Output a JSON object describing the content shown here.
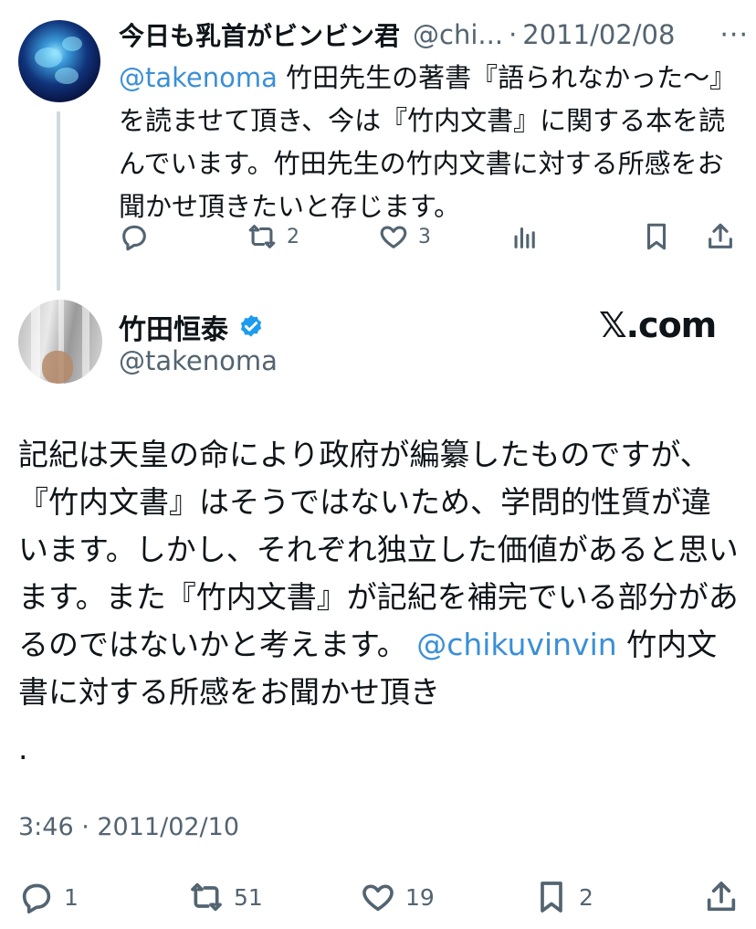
{
  "tweet1": {
    "author_name": "今日も乳首がビンビン君",
    "handle": "@chi...",
    "separator": "·",
    "date": "2011/02/08",
    "more": "···",
    "mention": "@takenoma",
    "text": "竹田先生の著書『語られなかった〜』を読ませて頂き、今は『竹内文書』に関する本を読んでいます。竹田先生の竹内文書に対する所感をお聞かせ頂きたいと存じます。",
    "retweets": "2",
    "likes": "3"
  },
  "tweet2": {
    "author_name": "竹田恒泰",
    "handle": "@takenoma",
    "brand": "𝕏.com",
    "text_before_mention": "記紀は天皇の命により政府が編纂したものですが、『竹内文書』はそうではないため、学問的性質が違います。しかし、それぞれ独立した価値があると思います。また『竹内文書』が記紀を補完でいる部分があるのではないかと考えます。",
    "mention": "@chikuvinvin",
    "text_after_mention": " 竹内文書に対する所感をお聞かせ頂き",
    "trailing": ".",
    "timestamp": "3:46 · 2011/02/10",
    "replies": "1",
    "retweets": "51",
    "likes": "19",
    "bookmarks": "2"
  },
  "icons": {
    "reply": "reply-icon",
    "retweet": "retweet-icon",
    "like": "heart-icon",
    "views": "views-icon",
    "bookmark": "bookmark-icon",
    "share": "share-icon",
    "verified": "verified-badge-icon"
  },
  "colors": {
    "link": "#3b8fd6",
    "muted": "#536471",
    "verified": "#1d9bf0",
    "thread_line": "#cfd9de"
  }
}
